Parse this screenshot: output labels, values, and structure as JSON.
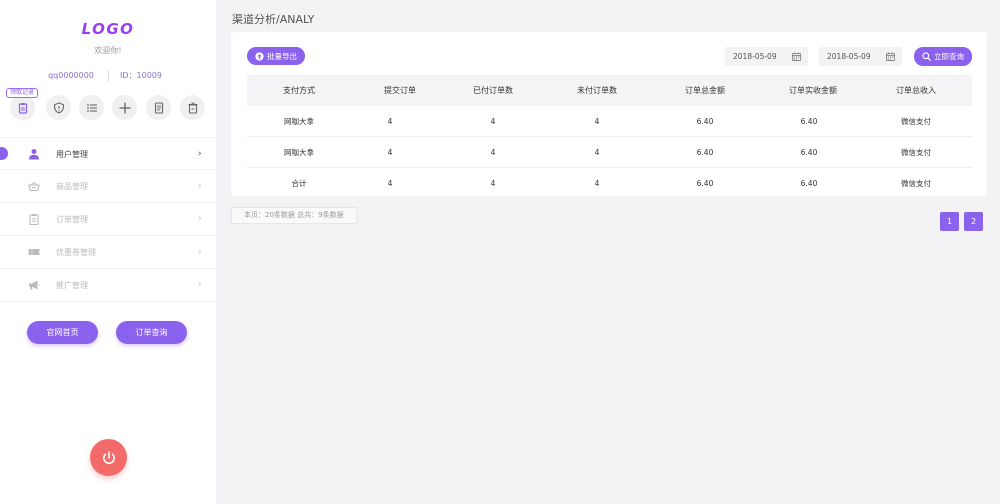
{
  "sidebar": {
    "logo": "LOGO",
    "welcome": "欢迎你!",
    "account": "qq0000000",
    "user_id": "ID：10009",
    "badge": "领取记录",
    "quick_icons": [
      "clipboard-icon",
      "shield-icon",
      "list-icon",
      "plus-icon",
      "document-icon",
      "trash-icon"
    ],
    "menu": [
      {
        "label": "用户管理",
        "icon": "user-icon",
        "active": true
      },
      {
        "label": "商品管理",
        "icon": "basket-icon",
        "active": false
      },
      {
        "label": "订单管理",
        "icon": "clipboard-icon",
        "active": false
      },
      {
        "label": "优惠券管理",
        "icon": "ticket-icon",
        "active": false
      },
      {
        "label": "推广管理",
        "icon": "megaphone-icon",
        "active": false
      }
    ],
    "arrow": "›",
    "buttons": {
      "home": "官网首页",
      "orders": "订单查询"
    },
    "power_icon": "power-icon"
  },
  "main": {
    "title": "渠道分析/ANALY",
    "export_label": "批量导出",
    "date_from": "2018-05-09",
    "date_to": "2018-05-09",
    "query_label": "立即查询",
    "table": {
      "headers": [
        "支付方式",
        "提交订单",
        "已付订单数",
        "未付订单数",
        "订单总金额",
        "订单实收金额",
        "订单总收入"
      ],
      "rows": [
        [
          "网咖大拿",
          "4",
          "4",
          "4",
          "6.40",
          "6.40",
          "微信支付"
        ],
        [
          "网咖大拿",
          "4",
          "4",
          "4",
          "6.40",
          "6.40",
          "微信支付"
        ],
        [
          "合计",
          "4",
          "4",
          "4",
          "6.40",
          "6.40",
          "微信支付"
        ]
      ]
    },
    "pager": {
      "info": "本页：20条数据  总共：9条数据",
      "pages": [
        "1",
        "2"
      ]
    }
  },
  "colors": {
    "accent": "#8b62ee",
    "logo": "#9b3df0",
    "power": "#f26a6a"
  }
}
